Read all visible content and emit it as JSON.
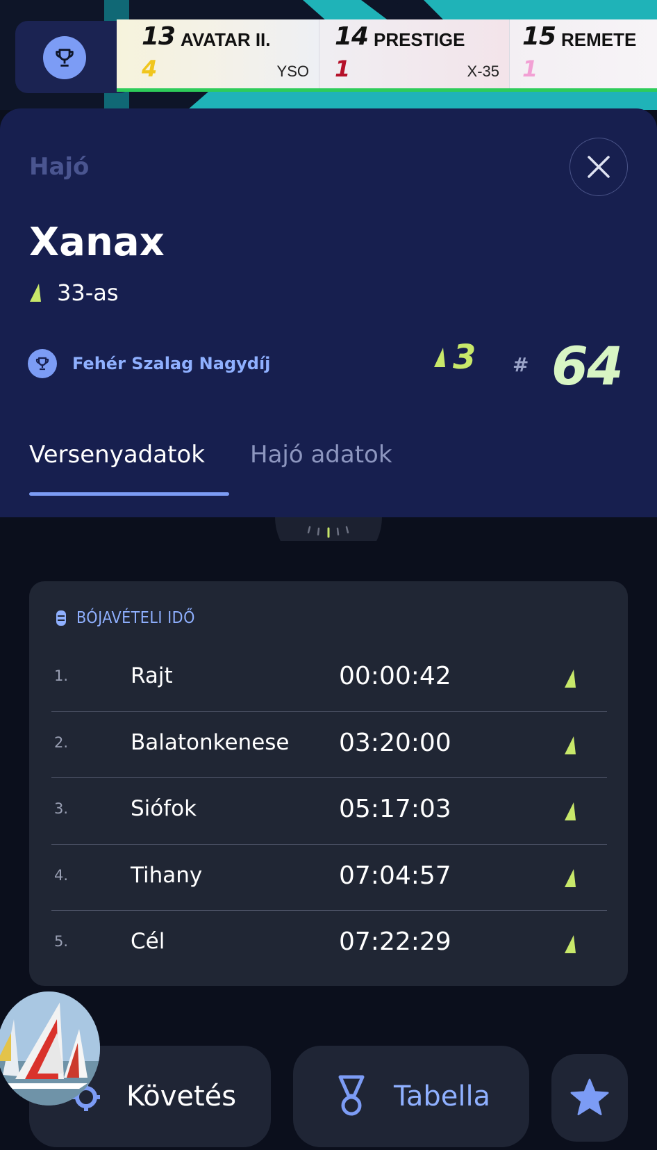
{
  "ticker": [
    {
      "number": "13",
      "name": "AVATAR II.",
      "rank": "4",
      "rank_color": "#f0c61e",
      "class": "YSO"
    },
    {
      "number": "14",
      "name": "PRESTIGE",
      "rank": "1",
      "rank_color": "#b5112a",
      "class": "X-35"
    },
    {
      "number": "15",
      "name": "REMETE",
      "rank": "1",
      "rank_color": "#f2a0d4",
      "class": ""
    }
  ],
  "panel": {
    "label": "Hajó",
    "boat_name": "Xanax",
    "boat_class": "33-as",
    "race_name": "Fehér Szalag Nagydíj",
    "class_rank": "3",
    "hash": "#",
    "overall_number": "64",
    "tabs": [
      {
        "label": "Versenyadatok",
        "active": true
      },
      {
        "label": "Hajó adatok",
        "active": false
      }
    ]
  },
  "card": {
    "title": "BÓJAVÉTELI IDŐ",
    "rows": [
      {
        "index": "1.",
        "name": "Rajt",
        "time": "00:00:42"
      },
      {
        "index": "2.",
        "name": "Balatonkenese",
        "time": "03:20:00"
      },
      {
        "index": "3.",
        "name": "Siófok",
        "time": "05:17:03"
      },
      {
        "index": "4.",
        "name": "Tihany",
        "time": "07:04:57"
      },
      {
        "index": "5.",
        "name": "Cél",
        "time": "07:22:29"
      }
    ]
  },
  "bottom": {
    "follow_label": "Követés",
    "table_label": "Tabella"
  },
  "colors": {
    "accent": "#7c9cf5",
    "sail_green": "#c8e86a",
    "panel_bg": "#171f4f",
    "card_bg": "#202634"
  }
}
